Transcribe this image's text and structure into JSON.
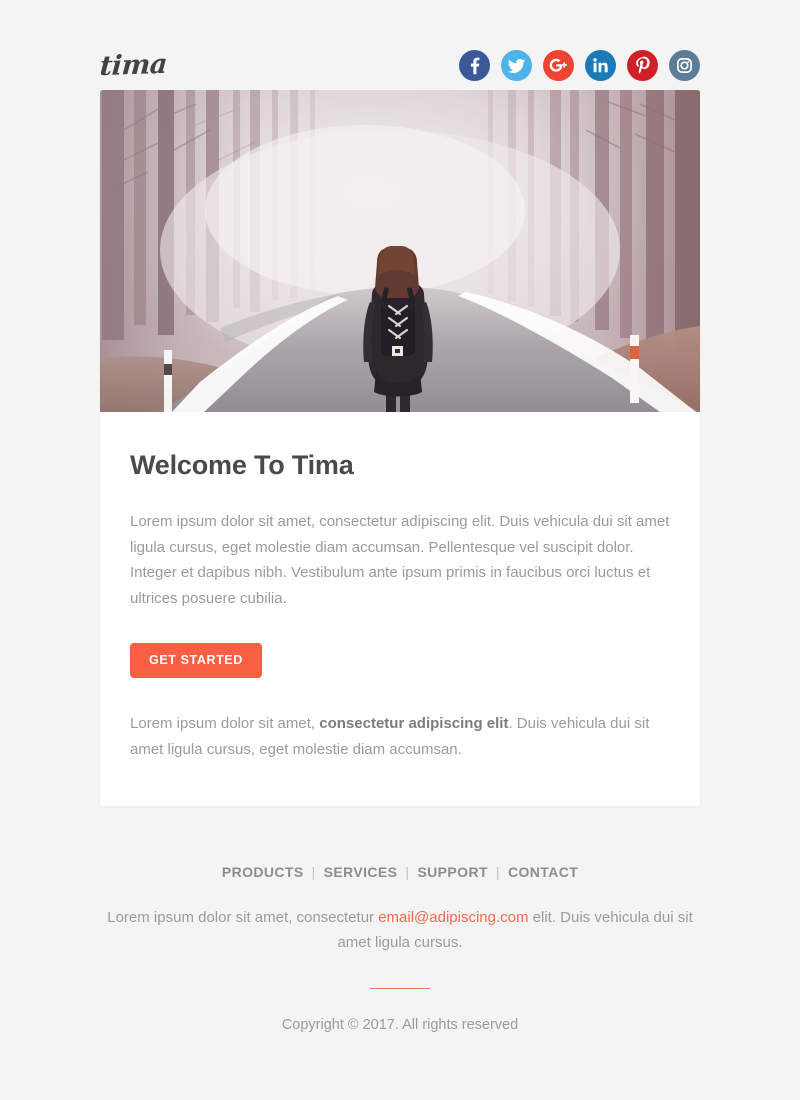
{
  "brand": {
    "logo_text": "tima"
  },
  "social": {
    "items": [
      {
        "name": "facebook",
        "label": "Facebook",
        "glyph": "f",
        "color": "#3b5998"
      },
      {
        "name": "twitter",
        "label": "Twitter",
        "glyph": "t",
        "color": "#4eb3e8"
      },
      {
        "name": "google-plus",
        "label": "Google Plus",
        "glyph": "G+",
        "color": "#ef4432"
      },
      {
        "name": "linkedin",
        "label": "LinkedIn",
        "glyph": "in",
        "color": "#1b7bb9"
      },
      {
        "name": "pinterest",
        "label": "Pinterest",
        "glyph": "P",
        "color": "#cf2027"
      },
      {
        "name": "instagram",
        "label": "Instagram",
        "glyph": "o",
        "color": "#5d7d96"
      }
    ]
  },
  "hero": {
    "alt": "Person with backpack walking down a foggy forest road"
  },
  "main": {
    "title": "Welcome To Tima",
    "paragraph_1": "Lorem ipsum dolor sit amet, consectetur adipiscing elit. Duis vehicula dui sit amet ligula cursus, eget molestie diam accumsan. Pellentesque vel suscipit dolor. Integer et dapibus nibh. Vestibulum ante ipsum primis in faucibus orci luctus et ultrices posuere cubilia.",
    "cta_label": "GET STARTED",
    "paragraph_2_before": "Lorem ipsum dolor sit amet, ",
    "paragraph_2_bold": "consectetur adipiscing elit",
    "paragraph_2_after": ". Duis vehicula dui sit amet ligula cursus, eget molestie diam accumsan."
  },
  "footer": {
    "nav": [
      {
        "label": "PRODUCTS"
      },
      {
        "label": "SERVICES"
      },
      {
        "label": "SUPPORT"
      },
      {
        "label": "CONTACT"
      }
    ],
    "separator": "|",
    "text_before": "Lorem ipsum dolor sit amet, consectetur ",
    "email": "email@adipiscing.com",
    "text_after": " elit. Duis vehicula dui sit amet ligula cursus.",
    "copyright": "Copyright © 2017. All rights reserved"
  },
  "colors": {
    "page_background": "#f4f4f4",
    "card_background": "#ffffff",
    "accent": "#fb5f43",
    "link": "#f8694c",
    "heading": "#4a4a4a",
    "body_text": "#9b9b9b",
    "divider": "#e07b62"
  }
}
